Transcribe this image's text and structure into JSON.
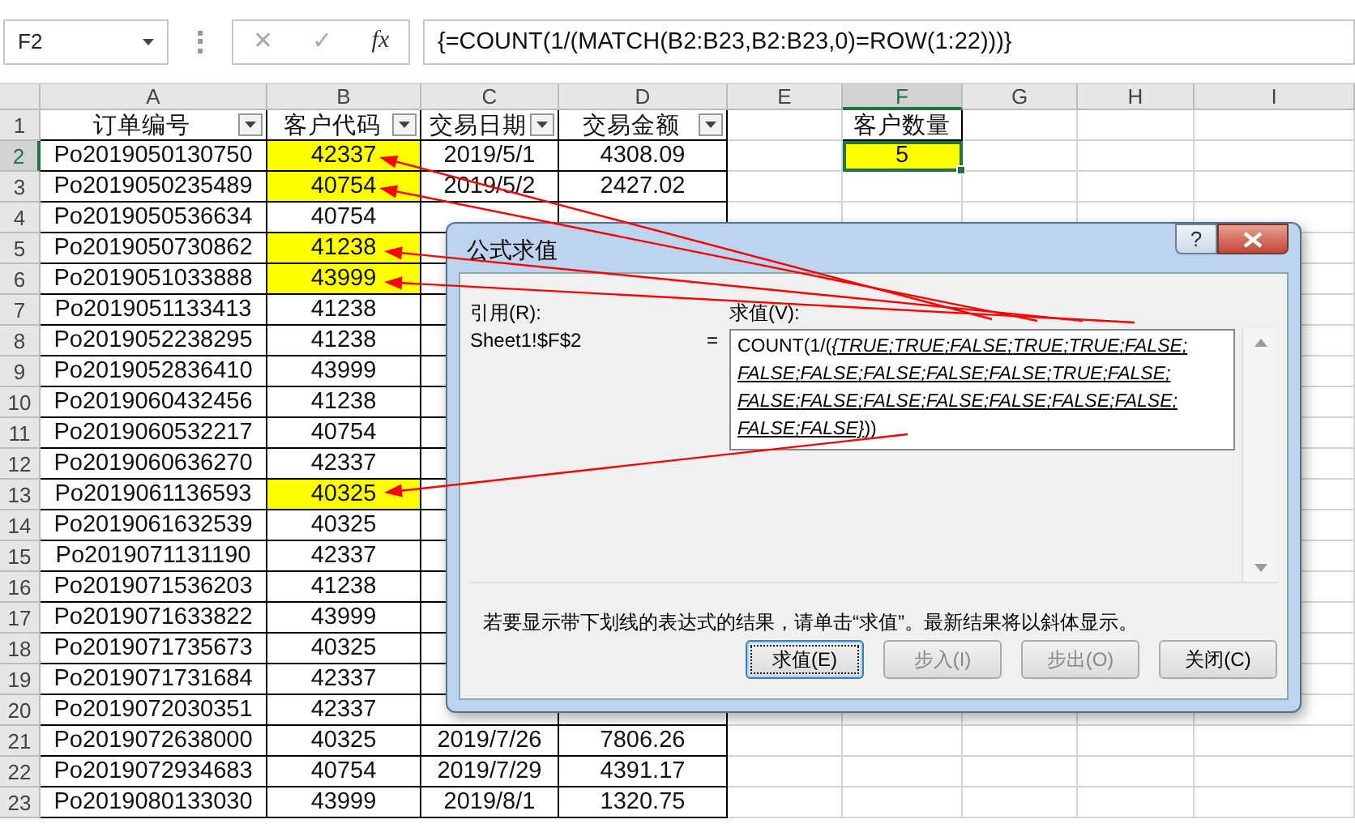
{
  "name_box": "F2",
  "formula_bar": {
    "cancel": "✕",
    "enter": "✓",
    "function": "fx",
    "formula": "{=COUNT(1/(MATCH(B2:B23,B2:B23,0)=ROW(1:22)))}"
  },
  "columns": [
    {
      "label": "A",
      "selected": false
    },
    {
      "label": "B",
      "selected": false
    },
    {
      "label": "C",
      "selected": false
    },
    {
      "label": "D",
      "selected": false
    },
    {
      "label": "E",
      "selected": false
    },
    {
      "label": "F",
      "selected": true
    },
    {
      "label": "G",
      "selected": false
    },
    {
      "label": "H",
      "selected": false
    },
    {
      "label": "I",
      "selected": false
    }
  ],
  "header": {
    "number": "1",
    "selected": false,
    "order_no": "订单编号",
    "customer_code": "客户代码",
    "date": "交易日期",
    "amount": "交易金额",
    "count_label": "客户数量"
  },
  "rows": [
    {
      "number": "2",
      "selected": true,
      "order_no": "Po2019050130750",
      "customer_code": "42337",
      "highlighted": true,
      "date": "2019/5/1",
      "amount": "4308.09",
      "count_value": "5"
    },
    {
      "number": "3",
      "selected": false,
      "order_no": "Po2019050235489",
      "customer_code": "40754",
      "highlighted": true,
      "date": "2019/5/2",
      "amount": "2427.02"
    },
    {
      "number": "4",
      "selected": false,
      "order_no": "Po2019050536634",
      "customer_code": "40754",
      "highlighted": false
    },
    {
      "number": "5",
      "selected": false,
      "order_no": "Po2019050730862",
      "customer_code": "41238",
      "highlighted": true
    },
    {
      "number": "6",
      "selected": false,
      "order_no": "Po2019051033888",
      "customer_code": "43999",
      "highlighted": true
    },
    {
      "number": "7",
      "selected": false,
      "order_no": "Po2019051133413",
      "customer_code": "41238",
      "highlighted": false
    },
    {
      "number": "8",
      "selected": false,
      "order_no": "Po2019052238295",
      "customer_code": "41238",
      "highlighted": false
    },
    {
      "number": "9",
      "selected": false,
      "order_no": "Po2019052836410",
      "customer_code": "43999",
      "highlighted": false
    },
    {
      "number": "10",
      "selected": false,
      "order_no": "Po2019060432456",
      "customer_code": "41238",
      "highlighted": false
    },
    {
      "number": "11",
      "selected": false,
      "order_no": "Po2019060532217",
      "customer_code": "40754",
      "highlighted": false
    },
    {
      "number": "12",
      "selected": false,
      "order_no": "Po2019060636270",
      "customer_code": "42337",
      "highlighted": false
    },
    {
      "number": "13",
      "selected": false,
      "order_no": "Po2019061136593",
      "customer_code": "40325",
      "highlighted": true
    },
    {
      "number": "14",
      "selected": false,
      "order_no": "Po2019061632539",
      "customer_code": "40325",
      "highlighted": false
    },
    {
      "number": "15",
      "selected": false,
      "order_no": "Po2019071131190",
      "customer_code": "42337",
      "highlighted": false
    },
    {
      "number": "16",
      "selected": false,
      "order_no": "Po2019071536203",
      "customer_code": "41238",
      "highlighted": false
    },
    {
      "number": "17",
      "selected": false,
      "order_no": "Po2019071633822",
      "customer_code": "43999",
      "highlighted": false
    },
    {
      "number": "18",
      "selected": false,
      "order_no": "Po2019071735673",
      "customer_code": "40325",
      "highlighted": false
    },
    {
      "number": "19",
      "selected": false,
      "order_no": "Po2019071731684",
      "customer_code": "42337",
      "highlighted": false
    },
    {
      "number": "20",
      "selected": false,
      "order_no": "Po2019072030351",
      "customer_code": "42337",
      "highlighted": false
    },
    {
      "number": "21",
      "selected": false,
      "order_no": "Po2019072638000",
      "customer_code": "40325",
      "highlighted": false,
      "date": "2019/7/26",
      "amount": "7806.26"
    },
    {
      "number": "22",
      "selected": false,
      "order_no": "Po2019072934683",
      "customer_code": "40754",
      "highlighted": false,
      "date": "2019/7/29",
      "amount": "4391.17"
    },
    {
      "number": "23",
      "selected": false,
      "order_no": "Po2019080133030",
      "customer_code": "43999",
      "highlighted": false,
      "date": "2019/8/1",
      "amount": "1320.75"
    }
  ],
  "dialog": {
    "title": "公式求值",
    "help": "?",
    "reference_label": "引用(R):",
    "reference": "Sheet1!$F$2",
    "equals": "=",
    "evaluation_label": "求值(V):",
    "evaluation": {
      "before": "COUNT(1/(",
      "evaluated": "{TRUE;TRUE;FALSE;TRUE;TRUE;FALSE;FALSE;FALSE;FALSE;FALSE;FALSE;TRUE;FALSE;FALSE;FALSE;FALSE;FALSE;FALSE;FALSE;FALSE;FALSE;FALSE}",
      "after": "))"
    },
    "hint": "若要显示带下划线的表达式的结果，请单击“求值”。最新结果将以斜体显示。",
    "buttons": [
      {
        "label": "求值(E)",
        "disabled": false,
        "focused": true
      },
      {
        "label": "步入(I)",
        "disabled": true,
        "focused": false
      },
      {
        "label": "步出(O)",
        "disabled": true,
        "focused": false
      },
      {
        "label": "关闭(C)",
        "disabled": false,
        "focused": false
      }
    ]
  }
}
